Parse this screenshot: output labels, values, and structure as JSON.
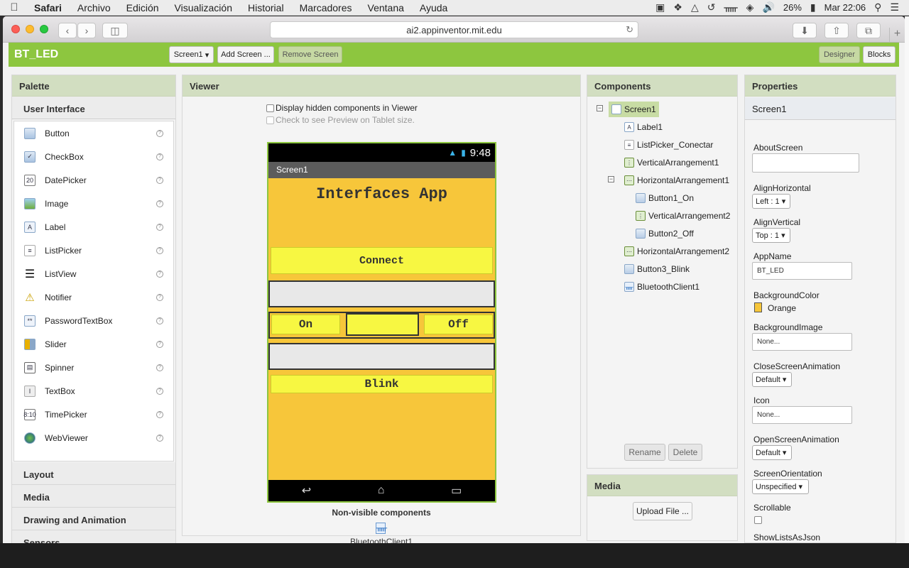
{
  "menubar": {
    "app": "Safari",
    "items": [
      "Archivo",
      "Edición",
      "Visualización",
      "Historial",
      "Marcadores",
      "Ventana",
      "Ayuda"
    ],
    "battery": "26%",
    "clock": "Mar 22:06"
  },
  "browser": {
    "url": "ai2.appinventor.mit.edu"
  },
  "app": {
    "title": "BT_LED",
    "screen_select": "Screen1",
    "add_screen": "Add Screen ...",
    "remove_screen": "Remove Screen",
    "designer": "Designer",
    "blocks": "Blocks"
  },
  "palette": {
    "title": "Palette",
    "open_section": "User Interface",
    "items": [
      {
        "label": "Button",
        "icon": "button-icon"
      },
      {
        "label": "CheckBox",
        "icon": "checkbox-icon"
      },
      {
        "label": "DatePicker",
        "icon": "datepicker-icon"
      },
      {
        "label": "Image",
        "icon": "image-icon"
      },
      {
        "label": "Label",
        "icon": "label-icon"
      },
      {
        "label": "ListPicker",
        "icon": "listpicker-icon"
      },
      {
        "label": "ListView",
        "icon": "listview-icon"
      },
      {
        "label": "Notifier",
        "icon": "notifier-icon"
      },
      {
        "label": "PasswordTextBox",
        "icon": "password-icon"
      },
      {
        "label": "Slider",
        "icon": "slider-icon"
      },
      {
        "label": "Spinner",
        "icon": "spinner-icon"
      },
      {
        "label": "TextBox",
        "icon": "textbox-icon"
      },
      {
        "label": "TimePicker",
        "icon": "timepicker-icon"
      },
      {
        "label": "WebViewer",
        "icon": "webviewer-icon"
      }
    ],
    "sections": [
      "Layout",
      "Media",
      "Drawing and Animation",
      "Sensors"
    ]
  },
  "viewer": {
    "title": "Viewer",
    "hidden_checkbox": "Display hidden components in Viewer",
    "tablet_checkbox": "Check to see Preview on Tablet size.",
    "phone": {
      "time": "9:48",
      "screen_title": "Screen1",
      "app_title": "Interfaces App",
      "connect": "Connect",
      "on": "On",
      "off": "Off",
      "blink": "Blink"
    },
    "nonvisible_title": "Non-visible components",
    "nonvisible_item": "BluetoothClient1"
  },
  "components": {
    "title": "Components",
    "tree": [
      "Screen1",
      "Label1",
      "ListPicker_Conectar",
      "VerticalArrangement1",
      "HorizontalArrangement1",
      "Button1_On",
      "VerticalArrangement2",
      "Button2_Off",
      "HorizontalArrangement2",
      "Button3_Blink",
      "BluetoothClient1"
    ],
    "rename": "Rename",
    "delete": "Delete"
  },
  "media": {
    "title": "Media",
    "upload": "Upload File ..."
  },
  "properties": {
    "title": "Properties",
    "component": "Screen1",
    "about_label": "AboutScreen",
    "alignh_label": "AlignHorizontal",
    "alignh_value": "Left : 1",
    "alignv_label": "AlignVertical",
    "alignv_value": "Top : 1",
    "appname_label": "AppName",
    "appname_value": "BT_LED",
    "bgcolor_label": "BackgroundColor",
    "bgcolor_value": "Orange",
    "bgimage_label": "BackgroundImage",
    "bgimage_value": "None...",
    "closeanim_label": "CloseScreenAnimation",
    "closeanim_value": "Default",
    "icon_label": "Icon",
    "icon_value": "None...",
    "openanim_label": "OpenScreenAnimation",
    "openanim_value": "Default",
    "orientation_label": "ScreenOrientation",
    "orientation_value": "Unspecified",
    "scrollable_label": "Scrollable",
    "showlists_label": "ShowListsAsJson"
  },
  "colors": {
    "accent_green": "#8dc63f",
    "phone_bg": "#f7c63a",
    "button_yellow": "#f7f742"
  }
}
